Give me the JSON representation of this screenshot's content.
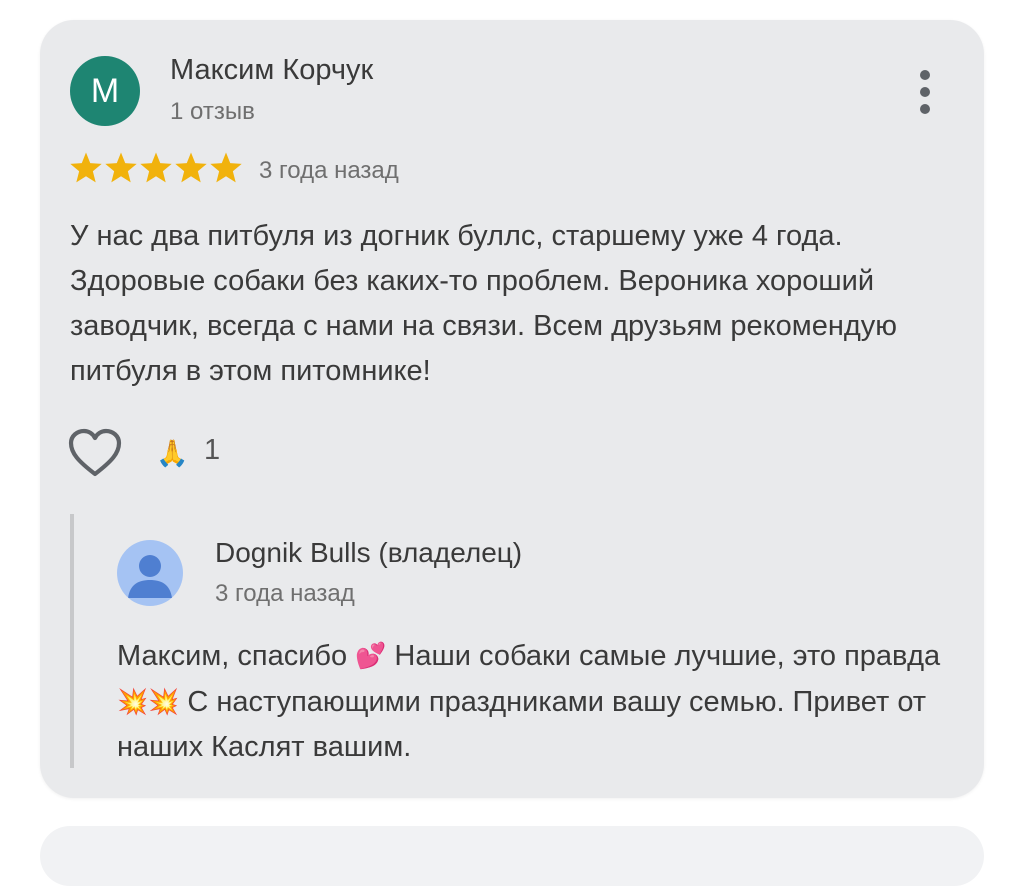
{
  "review": {
    "author_initial": "М",
    "author_name": "Максим Корчук",
    "review_count": "1 отзыв",
    "rating": 5,
    "rating_max": 5,
    "date": "3 года назад",
    "text": "У нас два питбуля из догник буллс, старшему уже 4 года. Здоровые собаки без каких-то проблем. Вероника хороший заводчик, всегда с нами на связи. Всем друзьям рекомендую питбуля в этом питомнике!",
    "reaction_emoji": "🙏",
    "reaction_count": "1",
    "menu_icon": "more-vert-icon",
    "like_icon": "heart-outline-icon"
  },
  "owner_reply": {
    "name": "Dognik Bulls (владелец)",
    "date": "3 года назад",
    "avatar_icon": "person-icon",
    "text_part1": "Максим, спасибо ",
    "emoji1": "💕",
    "text_part2": " Наши собаки самые лучшие, это правда ",
    "emoji2": "💥💥",
    "text_part3": " С наступающими праздниками вашу семью. Привет от наших Каслят вашим."
  },
  "colors": {
    "card_bg": "#e9eaec",
    "author_avatar_bg": "#1e8572",
    "star_color": "#f1b20c",
    "owner_avatar_bg": "#a5c3f3",
    "owner_avatar_figure": "#4f7fd1"
  }
}
